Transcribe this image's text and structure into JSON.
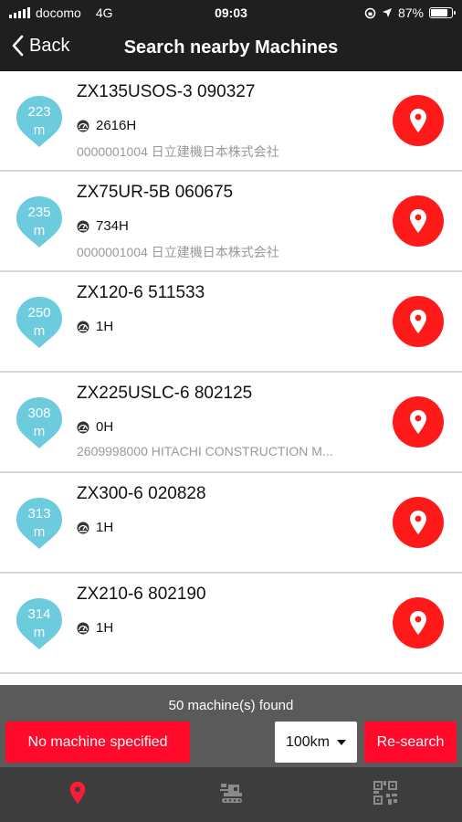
{
  "status_bar": {
    "carrier": "docomo",
    "network": "4G",
    "time": "09:03",
    "battery": "87%",
    "battery_level": 0.87
  },
  "nav": {
    "back_label": "Back",
    "title": "Search nearby Machines"
  },
  "machines": [
    {
      "distance": "223",
      "unit": "m",
      "name": "ZX135USOS-3 090327",
      "hours": "2616H",
      "owner": "0000001004 日立建機日本株式会社"
    },
    {
      "distance": "235",
      "unit": "m",
      "name": "ZX75UR-5B 060675",
      "hours": "734H",
      "owner": "0000001004 日立建機日本株式会社"
    },
    {
      "distance": "250",
      "unit": "m",
      "name": "ZX120-6 511533",
      "hours": "1H",
      "owner": ""
    },
    {
      "distance": "308",
      "unit": "m",
      "name": "ZX225USLC-6 802125",
      "hours": "0H",
      "owner": "2609998000 HITACHI CONSTRUCTION M..."
    },
    {
      "distance": "313",
      "unit": "m",
      "name": "ZX300-6 020828",
      "hours": "1H",
      "owner": ""
    },
    {
      "distance": "314",
      "unit": "m",
      "name": "ZX210-6 802190",
      "hours": "1H",
      "owner": ""
    }
  ],
  "bottom": {
    "found_text": "50 machine(s) found",
    "no_machine_label": "No machine specified",
    "range_value": "100km",
    "research_label": "Re-search"
  },
  "tabs": [
    {
      "icon": "map-pin-icon",
      "active": true
    },
    {
      "icon": "machine-icon",
      "active": false
    },
    {
      "icon": "qr-code-icon",
      "active": false
    }
  ],
  "colors": {
    "accent_red": "#ff1a1a",
    "pin_blue": "#6ccbdc",
    "header_bg": "#1f1f1f",
    "panel_bg": "#5a5a5a",
    "tabbar_bg": "#3d3d3d"
  }
}
